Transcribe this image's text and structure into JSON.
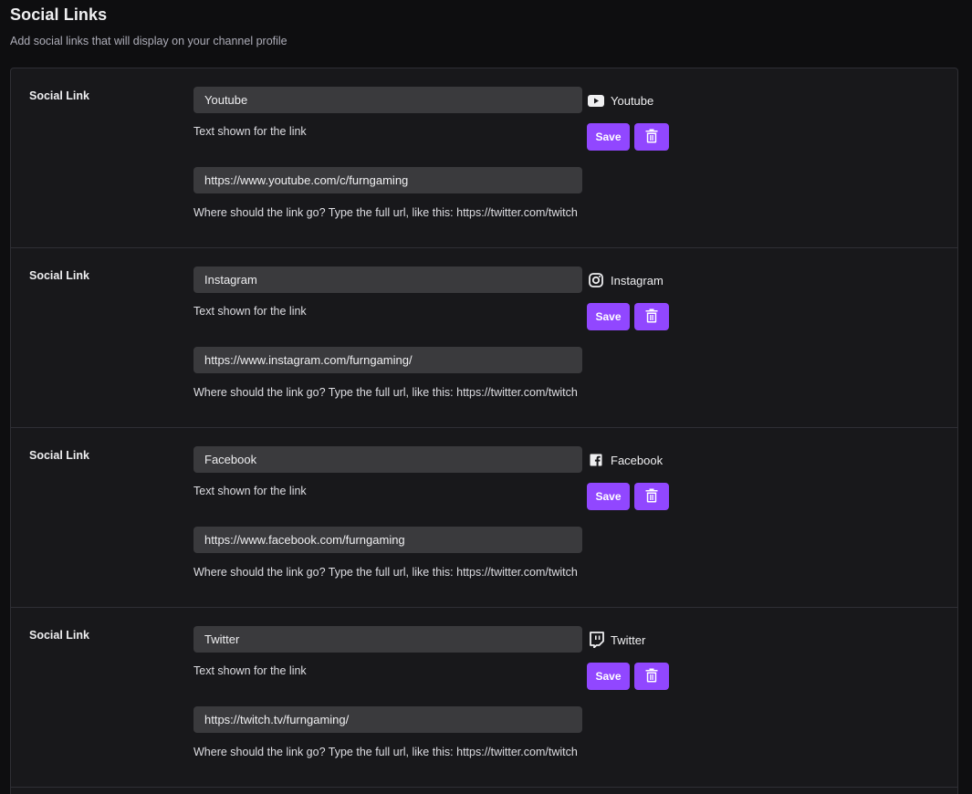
{
  "header": {
    "title": "Social Links",
    "subtitle": "Add social links that will display on your channel profile"
  },
  "colors": {
    "accent": "#9147ff",
    "background": "#0e0e10",
    "panel": "#18181b",
    "input": "#3a3a3d"
  },
  "links": [
    {
      "label": "Social Link",
      "title_value": "Youtube",
      "title_hint": "Text shown for the link",
      "url_value": "https://www.youtube.com/c/furngaming",
      "url_hint": "Where should the link go? Type the full url, like this: https://twitter.com/twitch",
      "platform": "Youtube",
      "platform_icon": "youtube-icon",
      "save_label": "Save",
      "delete_icon": "trash-icon"
    },
    {
      "label": "Social Link",
      "title_value": "Instagram",
      "title_hint": "Text shown for the link",
      "url_value": "https://www.instagram.com/furngaming/",
      "url_hint": "Where should the link go? Type the full url, like this: https://twitter.com/twitch",
      "platform": "Instagram",
      "platform_icon": "instagram-icon",
      "save_label": "Save",
      "delete_icon": "trash-icon"
    },
    {
      "label": "Social Link",
      "title_value": "Facebook",
      "title_hint": "Text shown for the link",
      "url_value": "https://www.facebook.com/furngaming",
      "url_hint": "Where should the link go? Type the full url, like this: https://twitter.com/twitch",
      "platform": "Facebook",
      "platform_icon": "facebook-icon",
      "save_label": "Save",
      "delete_icon": "trash-icon"
    },
    {
      "label": "Social Link",
      "title_value": "Twitter",
      "title_hint": "Text shown for the link",
      "url_value": "https://twitch.tv/furngaming/",
      "url_hint": "Where should the link go? Type the full url, like this: https://twitter.com/twitch",
      "platform": "Twitter",
      "platform_icon": "twitch-icon",
      "save_label": "Save",
      "delete_icon": "trash-icon"
    }
  ]
}
